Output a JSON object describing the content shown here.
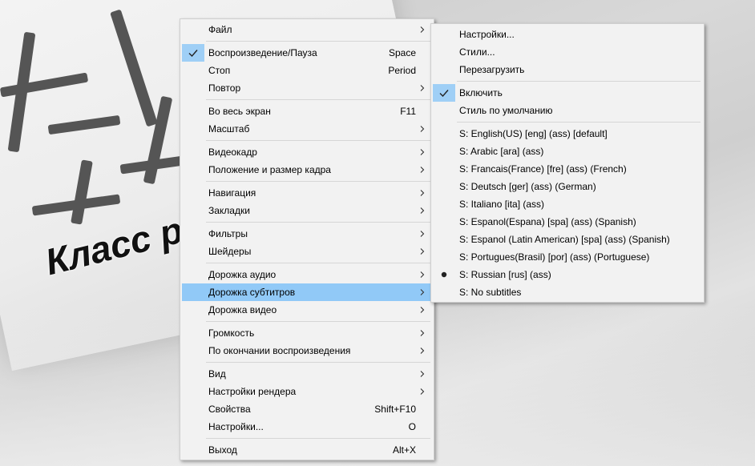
{
  "background": {
    "sign_text": "Класс р"
  },
  "main_menu": {
    "groups": [
      [
        {
          "label": "Файл",
          "submenu": true
        }
      ],
      [
        {
          "label": "Воспроизведение/Пауза",
          "shortcut": "Space",
          "checked": true
        },
        {
          "label": "Стоп",
          "shortcut": "Period"
        },
        {
          "label": "Повтор",
          "submenu": true
        }
      ],
      [
        {
          "label": "Во весь экран",
          "shortcut": "F11"
        },
        {
          "label": "Масштаб",
          "submenu": true
        }
      ],
      [
        {
          "label": "Видеокадр",
          "submenu": true
        },
        {
          "label": "Положение и размер кадра",
          "submenu": true
        }
      ],
      [
        {
          "label": "Навигация",
          "submenu": true
        },
        {
          "label": "Закладки",
          "submenu": true
        }
      ],
      [
        {
          "label": "Фильтры",
          "submenu": true
        },
        {
          "label": "Шейдеры",
          "submenu": true
        }
      ],
      [
        {
          "label": "Дорожка аудио",
          "submenu": true
        },
        {
          "label": "Дорожка субтитров",
          "submenu": true,
          "highlighted": true
        },
        {
          "label": "Дорожка видео",
          "submenu": true
        }
      ],
      [
        {
          "label": "Громкость",
          "submenu": true
        },
        {
          "label": "По окончании воспроизведения",
          "submenu": true
        }
      ],
      [
        {
          "label": "Вид",
          "submenu": true
        },
        {
          "label": "Настройки рендера",
          "submenu": true
        },
        {
          "label": "Свойства",
          "shortcut": "Shift+F10"
        },
        {
          "label": "Настройки...",
          "shortcut": "O"
        }
      ],
      [
        {
          "label": "Выход",
          "shortcut": "Alt+X"
        }
      ]
    ]
  },
  "subtitle_menu": {
    "groups": [
      [
        {
          "label": "Настройки..."
        },
        {
          "label": "Стили..."
        },
        {
          "label": "Перезагрузить"
        }
      ],
      [
        {
          "label": "Включить",
          "checked": true
        },
        {
          "label": "Стиль по умолчанию"
        }
      ],
      [
        {
          "label": "S: English(US) [eng] (ass) [default]"
        },
        {
          "label": "S: Arabic [ara] (ass)"
        },
        {
          "label": "S: Francais(France) [fre] (ass) (French)"
        },
        {
          "label": "S: Deutsch [ger] (ass) (German)"
        },
        {
          "label": "S: Italiano [ita] (ass)"
        },
        {
          "label": "S: Espanol(Espana) [spa] (ass) (Spanish)"
        },
        {
          "label": "S: Espanol (Latin American) [spa] (ass) (Spanish)"
        },
        {
          "label": "S: Portugues(Brasil) [por] (ass) (Portuguese)"
        },
        {
          "label": "S: Russian [rus] (ass)",
          "selected": true
        },
        {
          "label": "S: No subtitles"
        }
      ]
    ]
  },
  "colors": {
    "highlight": "#91c9f7",
    "menu_bg": "#f2f2f2",
    "check_bg": "#9fcff6"
  }
}
